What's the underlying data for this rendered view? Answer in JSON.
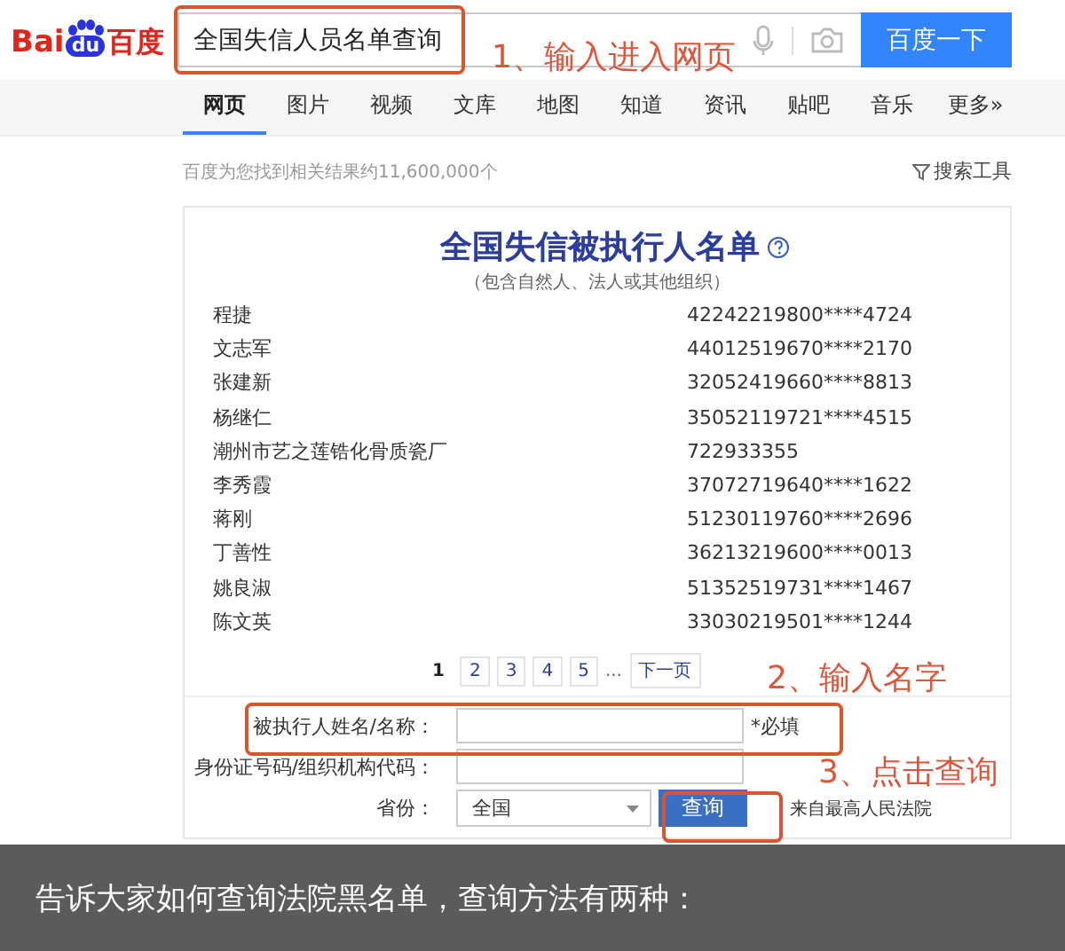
{
  "header": {
    "logo": {
      "latin": "Bai",
      "badge": "du",
      "chinese": "百度"
    },
    "search": {
      "value": "全国失信人员名单查询"
    },
    "search_button": "百度一下"
  },
  "tabs": [
    {
      "label": "网页",
      "selected": true
    },
    {
      "label": "图片",
      "selected": false
    },
    {
      "label": "视频",
      "selected": false
    },
    {
      "label": "文库",
      "selected": false
    },
    {
      "label": "地图",
      "selected": false
    },
    {
      "label": "知道",
      "selected": false
    },
    {
      "label": "资讯",
      "selected": false
    },
    {
      "label": "贴吧",
      "selected": false
    },
    {
      "label": "音乐",
      "selected": false
    },
    {
      "label": "更多»",
      "selected": false
    }
  ],
  "result_count": "百度为您找到相关结果约11,600,000个",
  "search_tools": "搜索工具",
  "card": {
    "title": "全国失信被执行人名单",
    "subtitle": "（包含自然人、法人或其他组织）",
    "rows": [
      {
        "name": "程捷",
        "id": "42242219800****4724"
      },
      {
        "name": "文志军",
        "id": "44012519670****2170"
      },
      {
        "name": "张建新",
        "id": "32052419660****8813"
      },
      {
        "name": "杨继仁",
        "id": "35052119721****4515"
      },
      {
        "name": "潮州市艺之莲锆化骨质瓷厂",
        "id": "722933355"
      },
      {
        "name": "李秀霞",
        "id": "37072719640****1622"
      },
      {
        "name": "蒋刚",
        "id": "51230119760****2696"
      },
      {
        "name": "丁善性",
        "id": "36213219600****0013"
      },
      {
        "name": "姚良淑",
        "id": "51352519731****1467"
      },
      {
        "name": "陈文英",
        "id": "33030219501****1244"
      }
    ],
    "pagination": [
      {
        "label": "1",
        "selected": true
      },
      {
        "label": "2",
        "selected": false
      },
      {
        "label": "3",
        "selected": false
      },
      {
        "label": "4",
        "selected": false
      },
      {
        "label": "5",
        "selected": false
      }
    ],
    "ellipsis": "...",
    "next": "下一页",
    "form": {
      "fields": [
        {
          "kind": "text",
          "label": "被执行人姓名/名称：",
          "note": "*必填"
        },
        {
          "kind": "text",
          "label": "身份证号码/组织机构代码："
        },
        {
          "kind": "select",
          "label": "省份：",
          "value": "全国"
        }
      ],
      "submit": "查询",
      "source": "来自最高人民法院"
    }
  },
  "annotations": [
    {
      "kind": "search",
      "text": "1、输入进入网页"
    },
    {
      "kind": "name",
      "text": "2、输入名字"
    },
    {
      "kind": "submit",
      "text": "3、点击查询"
    }
  ],
  "caption": "告诉大家如何查询法院黑名单，查询方法有两种："
}
